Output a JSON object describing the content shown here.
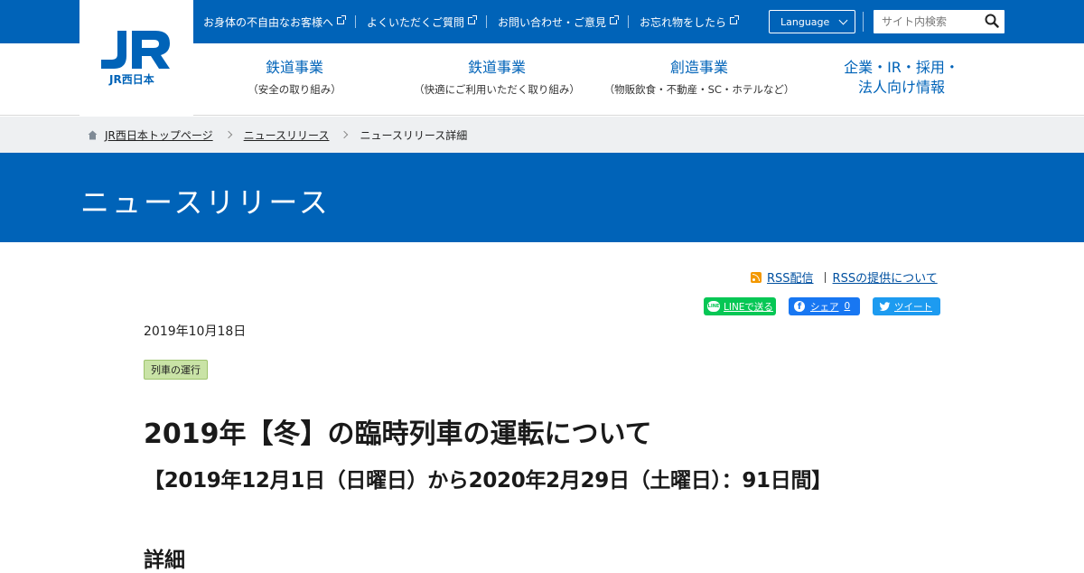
{
  "logo": {
    "text": "JR西日本"
  },
  "header": {
    "utility_links": [
      {
        "label": "お身体の不自由なお客様へ"
      },
      {
        "label": "よくいただくご質問"
      },
      {
        "label": "お問い合わせ・ご意見"
      },
      {
        "label": "お忘れ物をしたら"
      }
    ],
    "language_label": "Language",
    "search_placeholder": "サイト内検索"
  },
  "nav": {
    "items": [
      {
        "title": "鉄道事業",
        "sub": "（安全の取り組み）"
      },
      {
        "title": "鉄道事業",
        "sub": "（快適にご利用いただく取り組み）"
      },
      {
        "title": "創造事業",
        "sub": "（物販飲食・不動産・SC・ホテルなど）"
      },
      {
        "title_line1": "企業・IR・採用・",
        "title_line2": "法人向け情報"
      }
    ]
  },
  "breadcrumb": {
    "items": [
      {
        "label": "JR西日本トップページ"
      },
      {
        "label": "ニュースリリース"
      }
    ],
    "current": "ニュースリリース詳細"
  },
  "hero": {
    "title": "ニュースリリース"
  },
  "rss": {
    "feed_label": "RSS配信",
    "about_label": "RSSの提供について"
  },
  "share": {
    "line_label": "LINEで送る",
    "line_badge": "LINE",
    "fb_label": "シェア",
    "fb_count": "0",
    "tw_label": "ツイート"
  },
  "article": {
    "date": "2019年10月18日",
    "tag": "列車の運行",
    "title": "2019年【冬】の臨時列車の運転について",
    "subtitle": "【2019年12月1日（日曜日）から2020年2月29日（土曜日）：91日間】",
    "section_heading": "詳細"
  },
  "colors": {
    "brand_blue": "#0063b8",
    "breadcrumb_bg": "#eef0f2",
    "tag_bg": "#c9e3a6",
    "line_green": "#06c755",
    "fb_blue": "#1877f2",
    "tw_blue": "#1d9bf0",
    "rss_orange": "#f39800"
  }
}
